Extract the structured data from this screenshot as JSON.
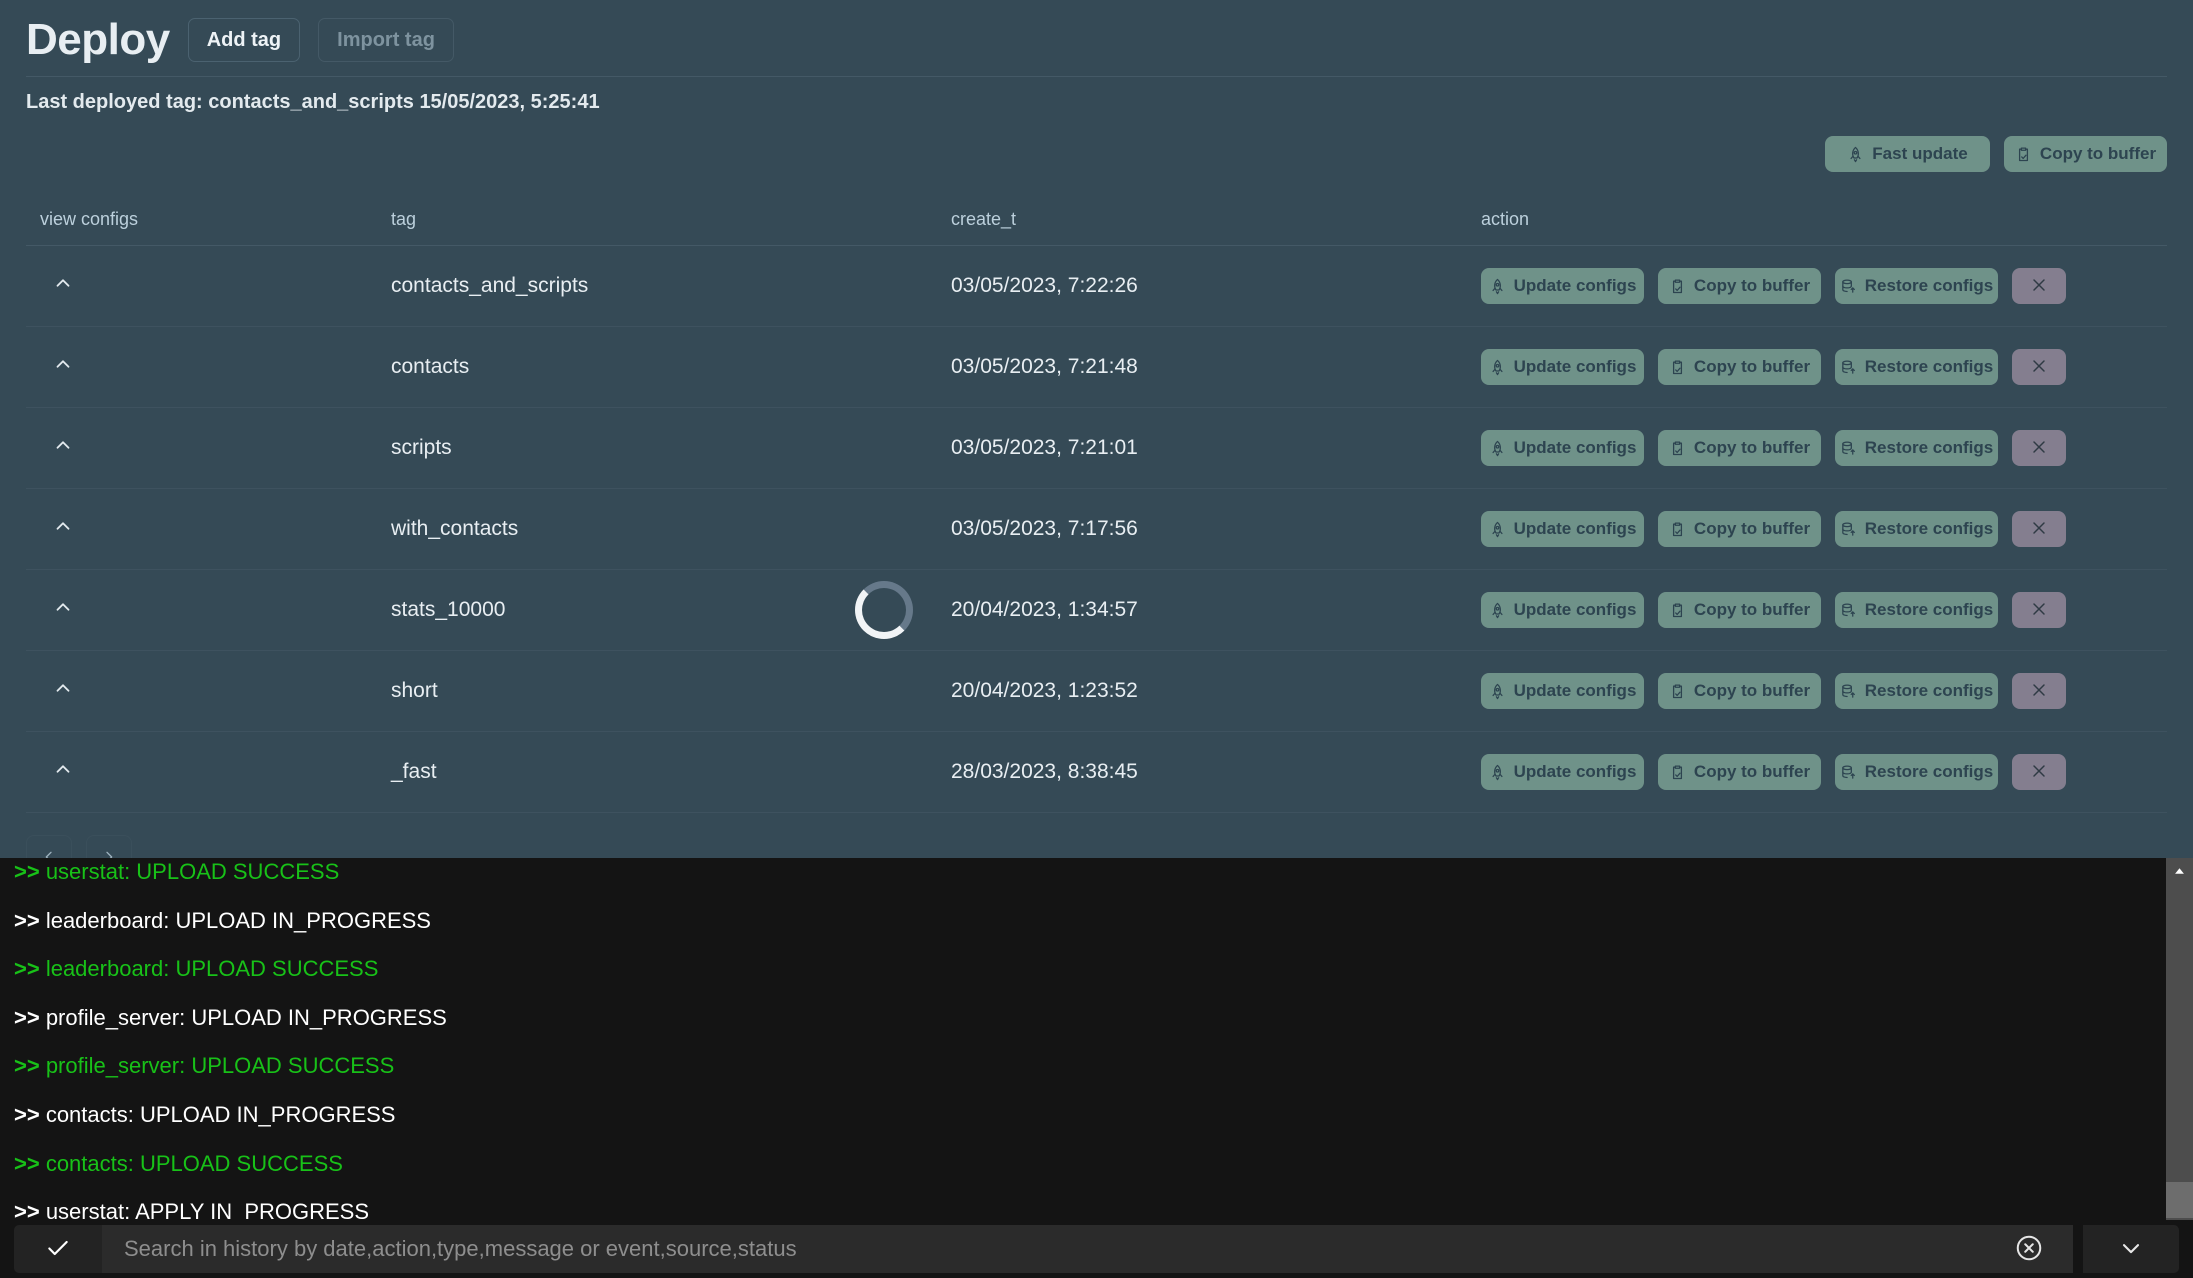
{
  "header": {
    "title": "Deploy",
    "add_tag_label": "Add tag",
    "import_tag_label": "Import tag",
    "last_deployed": "Last deployed tag: contacts_and_scripts 15/05/2023, 5:25:41"
  },
  "toolbar": {
    "fast_update_label": "Fast update",
    "copy_to_buffer_label": "Copy to buffer"
  },
  "table": {
    "columns": {
      "view_configs": "view configs",
      "tag": "tag",
      "create_t": "create_t",
      "action": "action"
    },
    "action_labels": {
      "update_configs": "Update configs",
      "copy_to_buffer": "Copy to buffer",
      "restore_configs": "Restore configs",
      "delete": "×"
    },
    "rows": [
      {
        "tag": "contacts_and_scripts",
        "create_t": "03/05/2023, 7:22:26",
        "loading": false
      },
      {
        "tag": "contacts",
        "create_t": "03/05/2023, 7:21:48",
        "loading": false
      },
      {
        "tag": "scripts",
        "create_t": "03/05/2023, 7:21:01",
        "loading": false
      },
      {
        "tag": "with_contacts",
        "create_t": "03/05/2023, 7:17:56",
        "loading": false
      },
      {
        "tag": "stats_10000",
        "create_t": "20/04/2023, 1:34:57",
        "loading": true
      },
      {
        "tag": "short",
        "create_t": "20/04/2023, 1:23:52",
        "loading": false
      },
      {
        "tag": "_fast",
        "create_t": "28/03/2023, 8:38:45",
        "loading": false
      }
    ]
  },
  "pagination": {
    "prev_label": "‹",
    "next_label": "›"
  },
  "console": {
    "lines": [
      {
        "text": ">> userstat: UPLOAD SUCCESS",
        "status": "success"
      },
      {
        "text": ">> leaderboard: UPLOAD IN_PROGRESS",
        "status": "progress"
      },
      {
        "text": ">> leaderboard: UPLOAD SUCCESS",
        "status": "success"
      },
      {
        "text": ">> profile_server: UPLOAD IN_PROGRESS",
        "status": "progress"
      },
      {
        "text": ">> profile_server: UPLOAD SUCCESS",
        "status": "success"
      },
      {
        "text": ">> contacts: UPLOAD IN_PROGRESS",
        "status": "progress"
      },
      {
        "text": ">> contacts: UPLOAD SUCCESS",
        "status": "success"
      },
      {
        "text": ">> userstat: APPLY IN_PROGRESS",
        "status": "progress"
      }
    ]
  },
  "search": {
    "placeholder": "Search in history by date,action,type,message or event,source,status",
    "value": ""
  },
  "colors": {
    "background": "#354a56",
    "pill": "#6f9289",
    "delete": "#847e8f",
    "console_bg": "#141414",
    "success_text": "#18c118"
  }
}
